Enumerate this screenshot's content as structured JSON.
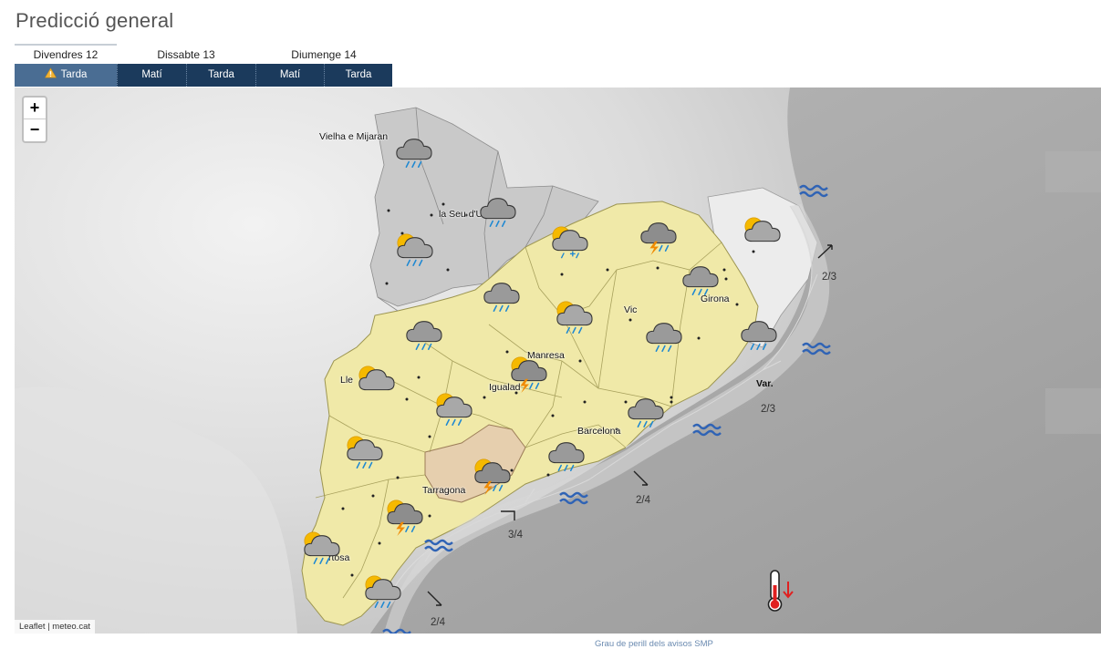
{
  "title": "Predicció general",
  "days": [
    {
      "label": "Divendres 12",
      "active": true
    },
    {
      "label": "Dissabte 13",
      "active": false
    },
    {
      "label": "Diumenge 14",
      "active": false
    }
  ],
  "periods": [
    {
      "label": "Tarda",
      "day": 0,
      "active": true,
      "warning": true
    },
    {
      "label": "Matí",
      "day": 1,
      "active": false
    },
    {
      "label": "Tarda",
      "day": 1,
      "active": false
    },
    {
      "label": "Matí",
      "day": 2,
      "active": false
    },
    {
      "label": "Tarda",
      "day": 2,
      "active": false
    }
  ],
  "zoom": {
    "in": "+",
    "out": "−"
  },
  "attribution": {
    "leaflet": "Leaflet",
    "separator": " | ",
    "source": "meteo.cat"
  },
  "cities": {
    "vielha": "Vielha e Mijaran",
    "seu": "la Seu d'Ur",
    "vic": "Vic",
    "girona": "Girona",
    "manresa": "Manresa",
    "lleida": "Lle",
    "igualada": "Igualad",
    "barcelona": "Barcelona",
    "tarragona": "Tarragona",
    "tortosa": "rtosa"
  },
  "sea": {
    "var": "Var.",
    "z1": "2/3",
    "z2": "2/3",
    "z3": "2/4",
    "z4": "3/4",
    "z5": "2/4"
  },
  "weather_icons": {
    "vielha": "cloud-rain-icon",
    "seu": "cloud-rain-icon",
    "aran_sud": "sun-cloud-rain-icon",
    "pallars": "cloud-rain-icon",
    "solsona": "cloud-rain-icon",
    "berga": "sun-cloud-sleet-icon",
    "ripolles": "cloud-storm-icon",
    "emporda": "sun-cloud-icon",
    "garrotxa": "cloud-rain-icon",
    "osona": "sun-cloud-rain-icon",
    "selva": "cloud-rain-icon",
    "costa_brava": "cloud-rain-icon",
    "lleida": "sun-cloud-icon",
    "anoia": "sun-cloud-storm-icon",
    "segarra": "sun-cloud-rain-icon",
    "maresme": "cloud-rain-icon",
    "garrigues": "sun-cloud-rain-icon",
    "penedes": "cloud-rain-icon",
    "tarragona": "sun-cloud-storm-icon",
    "priorat": "sun-cloud-storm-icon",
    "terra_alta": "sun-cloud-rain-icon",
    "montsia": "sun-cloud-rain-icon",
    "temperature": "thermometer-down-icon"
  },
  "colors": {
    "warning_yellow": "#f0e9a8",
    "warning_orange": "#e6cfae",
    "nav_dark": "#1b3a5c",
    "nav_active": "#4a6d93",
    "wave_blue": "#2f63b5"
  },
  "legend_link": "Grau de perill dels avisos SMP"
}
